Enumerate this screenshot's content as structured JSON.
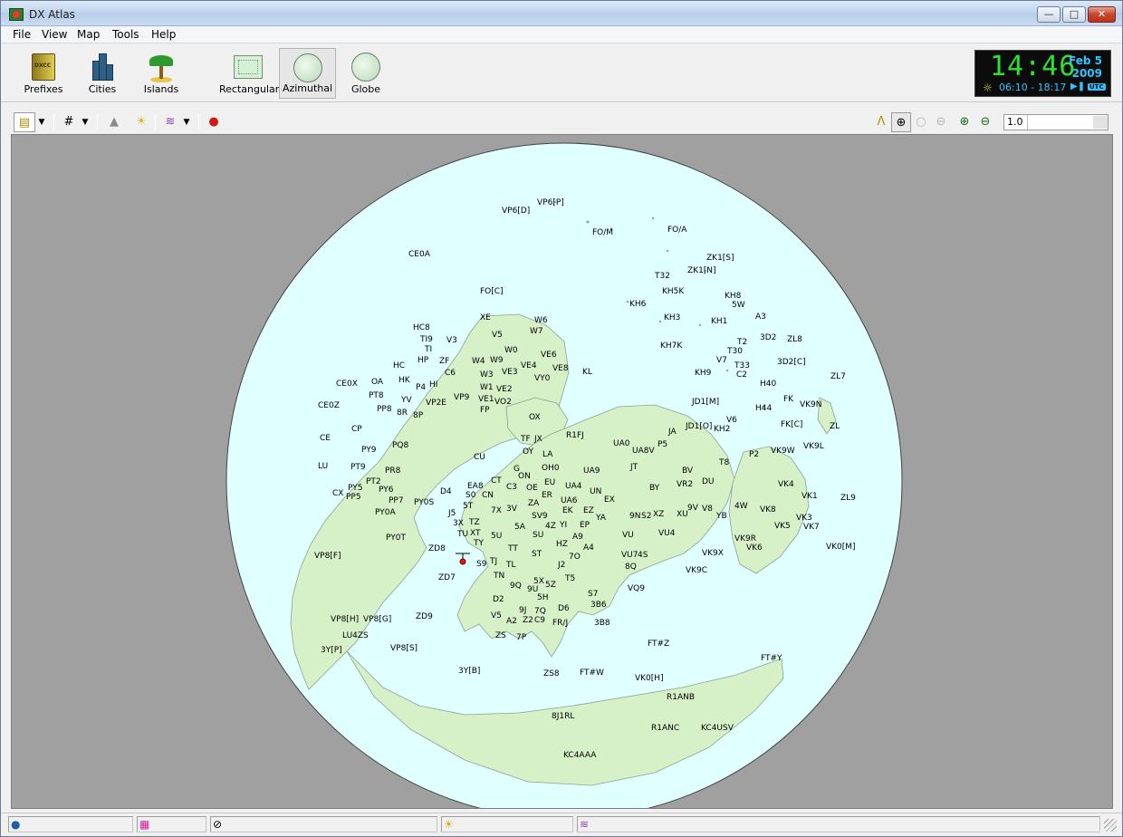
{
  "window": {
    "title": "DX Atlas"
  },
  "menu": [
    "File",
    "View",
    "Map",
    "Tools",
    "Help"
  ],
  "big_toolbar": {
    "prefixes": "Prefixes",
    "cities": "Cities",
    "islands": "Islands",
    "rectangular": "Rectangular",
    "azimuthal": "Azimuthal",
    "globe": "Globe",
    "active": "Azimuthal"
  },
  "clock": {
    "time": "14:46",
    "date_line1": "Feb 5",
    "date_line2": "2009",
    "sun_times": "06:10 - 18:17",
    "utc_badge": "UTC"
  },
  "small_toolbar": {
    "zoom_value": "1.0",
    "icons": [
      "info-icon",
      "grid-icon",
      "mountain-icon",
      "sun-icon",
      "propagation-icon",
      "pushpin-icon",
      "compass-icon",
      "crosshair-icon",
      "zoom-in-icon",
      "zoom-out-icon"
    ]
  },
  "colors": {
    "map_background": "#a0a0a0",
    "ocean": "#e0ffff",
    "land": "#d6f0c8",
    "land_border": "#9aa89a",
    "clock_green": "#2fe02f",
    "clock_blue": "#2ec5ff"
  },
  "prefix_labels": {
    "vp6p": "VP6[P]",
    "vp6d": "VP6[D]",
    "foa": "FO/A",
    "fom": "FO/M",
    "ce0a": "CE0A",
    "zk1s": "ZK1[S]",
    "zk1n": "ZK1[N]",
    "t32": "T32",
    "foc": "FO[C]",
    "kh5k": "KH5K",
    "kh8": "KH8",
    "kh6": "KH6",
    "5w": "5W",
    "kh3": "KH3",
    "kh1": "KH1",
    "a3": "A3",
    "xe": "XE",
    "w6": "W6",
    "hc8": "HC8",
    "w7": "W7",
    "v5": "V5",
    "ti9": "TI9",
    "v3": "V3",
    "kh7k": "KH7K",
    "w0": "W0",
    "3d2": "3D2",
    "zl8": "ZL8",
    "t2": "T2",
    "ti": "TI",
    "t30": "T30",
    "hp": "HP",
    "zf": "ZF",
    "w4": "W4",
    "w9": "W9",
    "ve6": "VE6",
    "3d2c": "3D2[C]",
    "v7": "V7",
    "t33": "T33",
    "hc": "HC",
    "ve4": "VE4",
    "ve8": "VE8",
    "c6": "C6",
    "kh9": "KH9",
    "c2": "C2",
    "ve3": "VE3",
    "w3": "W3",
    "kl": "KL",
    "zl7": "ZL7",
    "vy0": "VY0",
    "h40": "H40",
    "ce0x": "CE0X",
    "oa": "OA",
    "hk": "HK",
    "p4": "P4",
    "hi": "HI",
    "w1": "W1",
    "ve2": "VE2",
    "pt8": "PT8",
    "vp9": "VP9",
    "ve1": "VE1",
    "vo2": "VO2",
    "fk": "FK",
    "jd1m": "JD1[M]",
    "vk9n": "VK9N",
    "yv": "YV",
    "vp2e": "VP2E",
    "ce0z": "CE0Z",
    "pp8": "PP8",
    "8r": "8R",
    "fp": "FP",
    "h44": "H44",
    "v6": "V6",
    "8p": "8P",
    "ox": "OX",
    "fkc": "FK[C]",
    "zl": "ZL",
    "cp": "CP",
    "jd1o": "JD1[O]",
    "kh2": "KH2",
    "ja": "JA",
    "r1fj": "R1FJ",
    "ce": "CE",
    "tf": "TF",
    "jx": "JX",
    "pq8": "PQ8",
    "p5": "P5",
    "ua0": "UA0",
    "vk9l": "VK9L",
    "py9": "PY9",
    "oy": "OY",
    "ua8v": "UA8V",
    "p2": "P2",
    "vk9w": "VK9W",
    "la": "LA",
    "cu": "CU",
    "t8": "T8",
    "jt": "JT",
    "oh0": "OH0",
    "g": "G",
    "lu": "LU",
    "pt9": "PT9",
    "pr8": "PR8",
    "bv": "BV",
    "ua9": "UA9",
    "on": "ON",
    "eu": "EU",
    "du": "DU",
    "ct": "CT",
    "vr2": "VR2",
    "pt2": "PT2",
    "ea8": "EA8",
    "c3": "C3",
    "oe": "OE",
    "ua4": "UA4",
    "vk4": "VK4",
    "py5": "PY5",
    "py6": "PY6",
    "d4": "D4",
    "by": "BY",
    "un": "UN",
    "cx": "CX",
    "s0": "S0",
    "cn": "CN",
    "er": "ER",
    "vk1": "VK1",
    "pp5": "PP5",
    "pp7": "PP7",
    "ua6": "UA6",
    "ex": "EX",
    "za": "ZA",
    "zl9": "ZL9",
    "py0s": "PY0S",
    "5t": "5T",
    "3v": "3V",
    "4w": "4W",
    "7x": "7X",
    "ek": "EK",
    "ez": "EZ",
    "xz": "XZ",
    "xu": "XU",
    "v8": "V8",
    "vk8": "VK8",
    "j5": "J5",
    "sv9": "SV9",
    "9v": "9V",
    "py0a": "PY0A",
    "ya": "YA",
    "yb": "YB",
    "vk3": "VK3",
    "9n": "9N",
    "s2": "S2",
    "3x": "3X",
    "tz": "TZ",
    "4z": "4Z",
    "yi": "YI",
    "ep": "EP",
    "5a": "5A",
    "vk5": "VK5",
    "vk7": "VK7",
    "tu": "TU",
    "xt": "XT",
    "su": "SU",
    "a9": "A9",
    "vu": "VU",
    "vu4": "VU4",
    "5u": "5U",
    "py0t": "PY0T",
    "vk9r": "VK9R",
    "ty": "TY",
    "hz": "HZ",
    "a4": "A4",
    "vk6": "VK6",
    "vk0m": "VK0[M]",
    "zd8": "ZD8",
    "tt": "TT",
    "st": "ST",
    "vu7": "VU7",
    "4s": "4S",
    "vk9x": "VK9X",
    "vp8f": "VP8[F]",
    "7o": "7O",
    "s9": "S9",
    "tj": "TJ",
    "tl": "TL",
    "j2": "J2",
    "8q": "8Q",
    "vk9c": "VK9C",
    "zd7": "ZD7",
    "tn": "TN",
    "5x": "5X",
    "t5": "T5",
    "9q": "9Q",
    "9u": "9U",
    "5z": "5Z",
    "vq9": "VQ9",
    "5h": "5H",
    "s7": "S7",
    "d2": "D2",
    "9j": "9J",
    "3b6": "3B6",
    "7q": "7Q",
    "d6": "D6",
    "vp8h": "VP8[H]",
    "vp8g": "VP8[G]",
    "zd9": "ZD9",
    "v5b": "V5",
    "a2": "A2",
    "z2": "Z2",
    "c9": "C9",
    "fr_j": "FR/J",
    "3b8": "3B8",
    "lu4zs": "LU4ZS",
    "zs": "ZS",
    "7p": "7P",
    "ftz": "FT#Z",
    "3yp": "3Y[P]",
    "vp8s": "VP8[S]",
    "fty": "FT#Y",
    "3yb": "3Y[B]",
    "zs8": "ZS8",
    "ftw": "FT#W",
    "vk0h": "VK0[H]",
    "r1anb": "R1ANB",
    "8j1rl": "8J1RL",
    "r1anc": "R1ANC",
    "kc4usv": "KC4USV",
    "kc4aaa": "KC4AAA"
  }
}
